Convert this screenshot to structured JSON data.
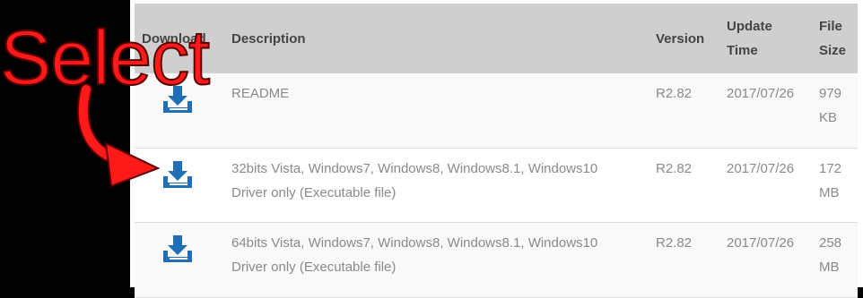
{
  "table": {
    "headers": {
      "download": "Download",
      "description": "Description",
      "version": "Version",
      "update_time_1": "Update",
      "update_time_2": "Time",
      "file_size_1": "File",
      "file_size_2": "Size"
    },
    "rows": [
      {
        "icon": "download-icon",
        "desc_1": "README",
        "desc_2": "",
        "version": "R2.82",
        "date": "2017/07/26",
        "size_1": "979",
        "size_2": "KB"
      },
      {
        "icon": "download-icon",
        "desc_1": "32bits Vista, Windows7, Windows8, Windows8.1, Windows10",
        "desc_2": "Driver only (Executable file)",
        "version": "R2.82",
        "date": "2017/07/26",
        "size_1": "172",
        "size_2": "MB"
      },
      {
        "icon": "download-icon",
        "desc_1": "64bits Vista, Windows7, Windows8, Windows8.1, Windows10",
        "desc_2": "Driver only (Executable file)",
        "version": "R2.82",
        "date": "2017/07/26",
        "size_1": "258",
        "size_2": "MB"
      }
    ]
  },
  "annotation": {
    "label": "Select",
    "color": "#ff1a1a"
  },
  "colors": {
    "icon_blue": "#1e6fb5",
    "header_bg": "#cfcfcf"
  }
}
